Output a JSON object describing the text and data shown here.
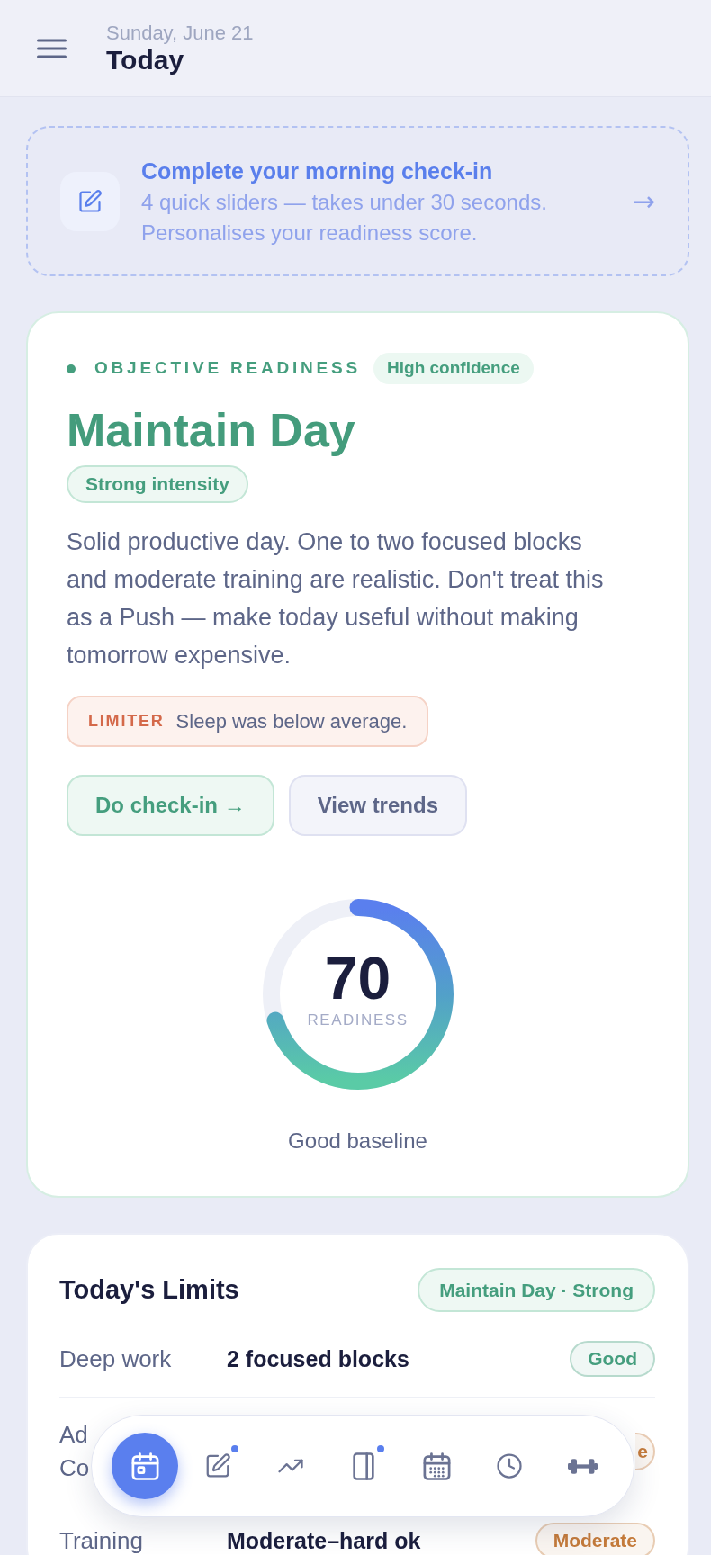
{
  "header": {
    "date": "Sunday, June 21",
    "title": "Today"
  },
  "checkin_banner": {
    "title": "Complete your morning check-in",
    "subtitle": "4 quick sliders — takes under 30 seconds. Personalises your readiness score.",
    "arrow": "→"
  },
  "readiness_card": {
    "label": "OBJECTIVE READINESS",
    "confidence": "High confidence",
    "headline": "Maintain Day",
    "intensity": "Strong intensity",
    "description": "Solid productive day. One to two focused blocks and moderate training are realistic. Don't treat this as a Push — make today useful without making tomorrow expensive.",
    "limiter": {
      "label": "LIMITER",
      "text": "Sleep was below average."
    },
    "buttons": [
      {
        "label": "Do check-in →",
        "kind": "primary"
      },
      {
        "label": "View trends",
        "kind": "secondary"
      }
    ],
    "score": {
      "value": "70",
      "label": "READINESS",
      "level": 0.7,
      "caption": "Good baseline"
    }
  },
  "limits_card": {
    "title": "Today's Limits",
    "tag": "Maintain Day · Strong",
    "rows": [
      {
        "kind": "full",
        "label": "Deep work",
        "value": "2 focused blocks",
        "badge": "Good",
        "color": "#459e7e"
      },
      {
        "kind": "covered",
        "label_lines": [
          "Ad",
          "Co"
        ],
        "badge": "e",
        "color": "#c47a3a"
      },
      {
        "kind": "full",
        "label": "Training",
        "value": "Moderate–hard ok",
        "badge": "Moderate",
        "color": "#c47a3a"
      }
    ]
  },
  "bottom_nav": [
    {
      "selected": true,
      "dot": false
    },
    {
      "selected": false,
      "dot": true
    },
    {
      "selected": false,
      "dot": false
    },
    {
      "selected": false,
      "dot": true
    },
    {
      "selected": false,
      "dot": false
    },
    {
      "selected": false,
      "dot": false
    },
    {
      "selected": false,
      "dot": false
    }
  ]
}
